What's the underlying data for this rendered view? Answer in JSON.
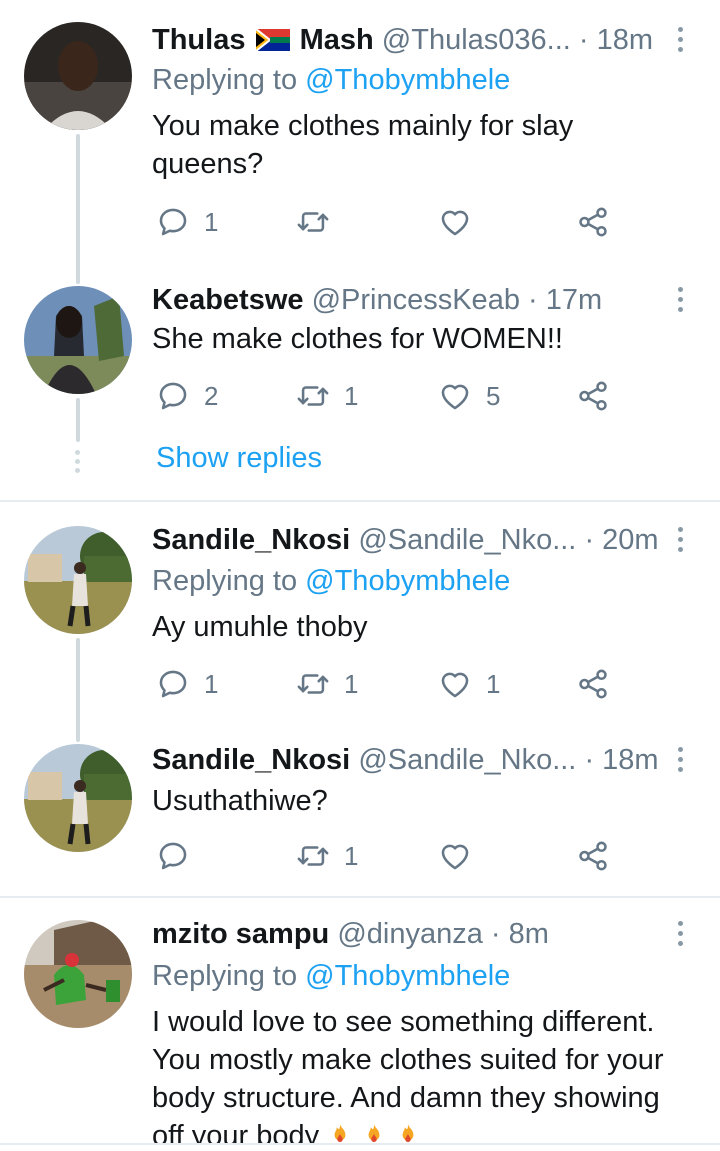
{
  "tweets": [
    {
      "name": "Thulas",
      "name_after_flag": "Mash",
      "handle": "@Thulas036...",
      "sep": "·",
      "time": "18m",
      "replying_prefix": "Replying to ",
      "replying_to": "@Thobymbhele",
      "text": "You make clothes mainly for slay queens?",
      "replies": "1",
      "retweets": "",
      "likes": ""
    },
    {
      "name": "Keabetswe",
      "handle": "@PrincessKeab",
      "sep": "·",
      "time": "17m",
      "text": "She make clothes for WOMEN!!",
      "replies": "2",
      "retweets": "1",
      "likes": "5"
    },
    {
      "name": "Sandile_Nkosi",
      "handle": "@Sandile_Nko...",
      "sep": "·",
      "time": "20m",
      "replying_prefix": "Replying to ",
      "replying_to": "@Thobymbhele",
      "text": "Ay umuhle thoby",
      "replies": "1",
      "retweets": "1",
      "likes": "1"
    },
    {
      "name": "Sandile_Nkosi",
      "handle": "@Sandile_Nko...",
      "sep": "·",
      "time": "18m",
      "text": "Usuthathiwe?",
      "replies": "",
      "retweets": "1",
      "likes": ""
    },
    {
      "name": "mzito sampu",
      "handle": "@dinyanza",
      "sep": "·",
      "time": "8m",
      "replying_prefix": "Replying to ",
      "replying_to": "@Thobymbhele",
      "text": "I would love to see something different. You mostly make clothes suited for your body structure. And damn they showing off your body"
    }
  ],
  "show_replies": "Show replies",
  "icons": [
    "reply-icon",
    "retweet-icon",
    "like-icon",
    "share-icon",
    "more-icon",
    "south-africa-flag-icon",
    "fire-icon"
  ],
  "colors": {
    "link": "#1da1f2",
    "muted": "#657786",
    "thread": "#cfd9de",
    "divider": "#e6ecf0"
  }
}
